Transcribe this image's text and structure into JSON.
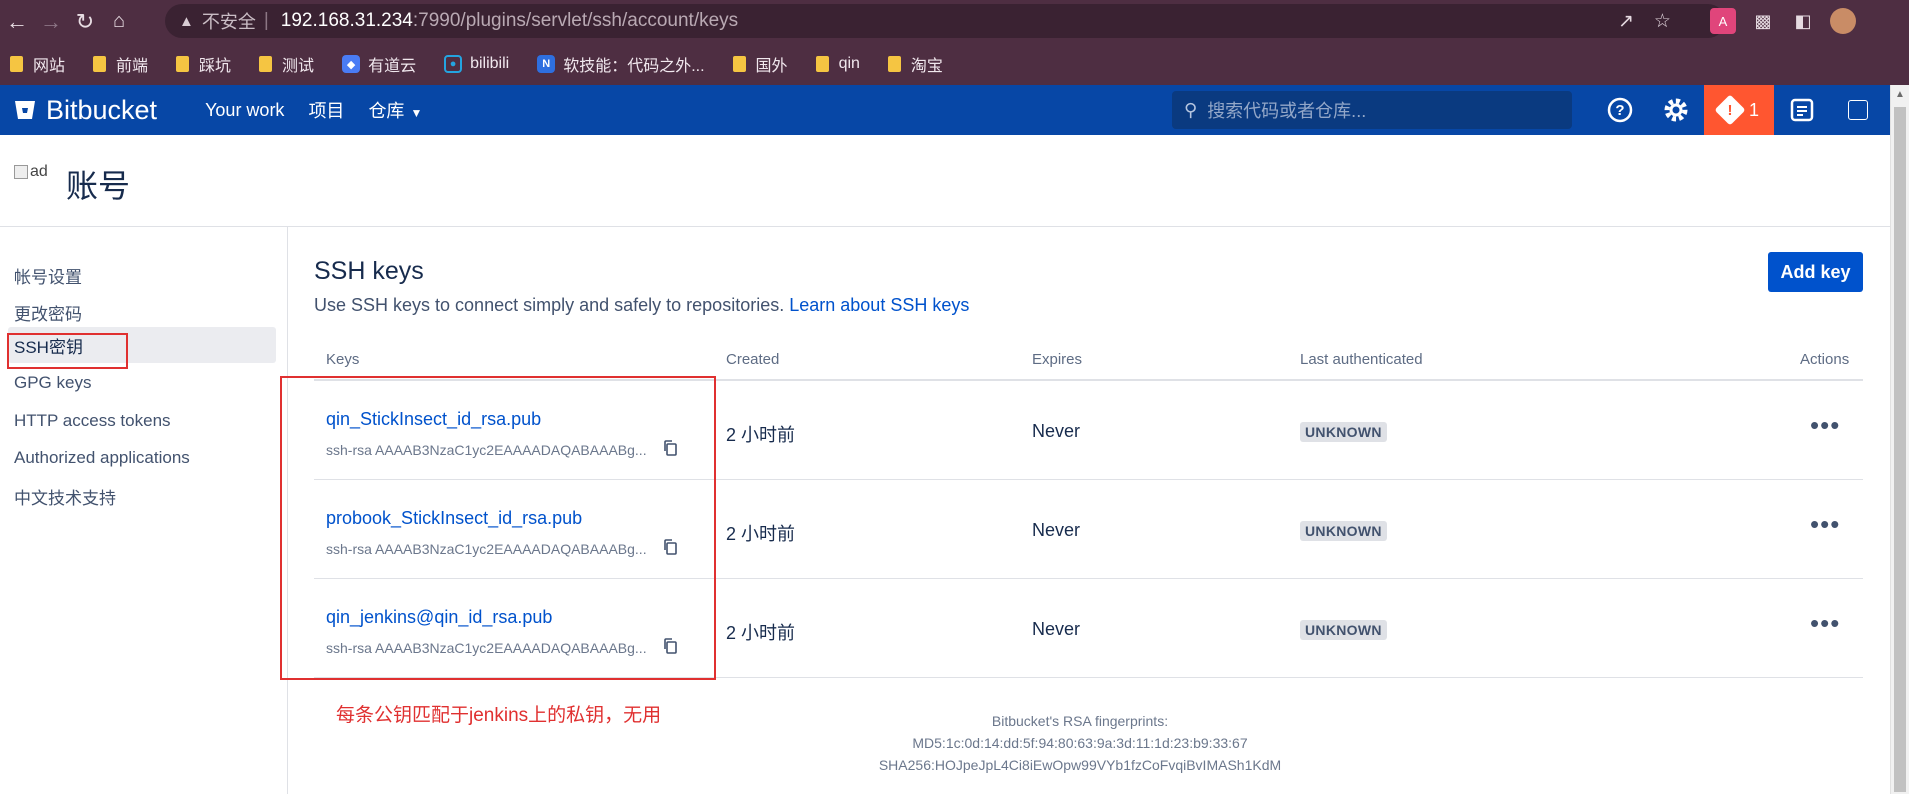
{
  "browser": {
    "insecure_label": "不安全",
    "url_host": "192.168.31.234",
    "url_rest": ":7990/plugins/servlet/ssh/account/keys"
  },
  "bookmarks": [
    {
      "label": "网站",
      "icon": "folder"
    },
    {
      "label": "前端",
      "icon": "folder"
    },
    {
      "label": "踩坑",
      "icon": "folder"
    },
    {
      "label": "测试",
      "icon": "folder"
    },
    {
      "label": "有道云",
      "icon": "youdao"
    },
    {
      "label": "bilibili",
      "icon": "bilibili"
    },
    {
      "label": "软技能：代码之外...",
      "icon": "n-logo"
    },
    {
      "label": "国外",
      "icon": "folder"
    },
    {
      "label": "qin",
      "icon": "folder"
    },
    {
      "label": "淘宝",
      "icon": "folder"
    }
  ],
  "header": {
    "logo": "Bitbucket",
    "nav": [
      "Your work",
      "项目",
      "仓库"
    ],
    "search_placeholder": "搜索代码或者仓库...",
    "alert_count": "1",
    "colors": {
      "bar": "#0747a6",
      "alert": "#ff5630"
    }
  },
  "page": {
    "avatar_alt": "ad",
    "title": "账号"
  },
  "sidebar": {
    "items": [
      "帐号设置",
      "更改密码",
      "SSH密钥",
      "GPG keys",
      "HTTP access tokens",
      "Authorized applications",
      "中文技术支持"
    ],
    "active_index": 2
  },
  "main": {
    "title": "SSH keys",
    "desc": "Use SSH keys to connect simply and safely to repositories.",
    "learn_link": "Learn about SSH keys",
    "add_button": "Add key",
    "columns": [
      "Keys",
      "Created",
      "Expires",
      "Last authenticated",
      "Actions"
    ],
    "rows": [
      {
        "name": "qin_StickInsect_id_rsa.pub",
        "key": "ssh-rsa AAAAB3NzaC1yc2EAAAADAQABAAABg...",
        "created": "2 小时前",
        "expires": "Never",
        "last_auth": "UNKNOWN"
      },
      {
        "name": "probook_StickInsect_id_rsa.pub",
        "key": "ssh-rsa AAAAB3NzaC1yc2EAAAADAQABAAABg...",
        "created": "2 小时前",
        "expires": "Never",
        "last_auth": "UNKNOWN"
      },
      {
        "name": "qin_jenkins@qin_id_rsa.pub",
        "key": "ssh-rsa AAAAB3NzaC1yc2EAAAADAQABAAABg...",
        "created": "2 小时前",
        "expires": "Never",
        "last_auth": "UNKNOWN"
      }
    ],
    "annotation": "每条公钥匹配于jenkins上的私钥，无用",
    "fingerprints": [
      "Bitbucket's RSA fingerprints:",
      "MD5:1c:0d:14:dd:5f:94:80:63:9a:3d:11:1d:23:b9:33:67",
      "SHA256:HOJpeJpL4Ci8iEwOpw99VYb1fzCoFvqiBvIMASh1KdM"
    ]
  }
}
